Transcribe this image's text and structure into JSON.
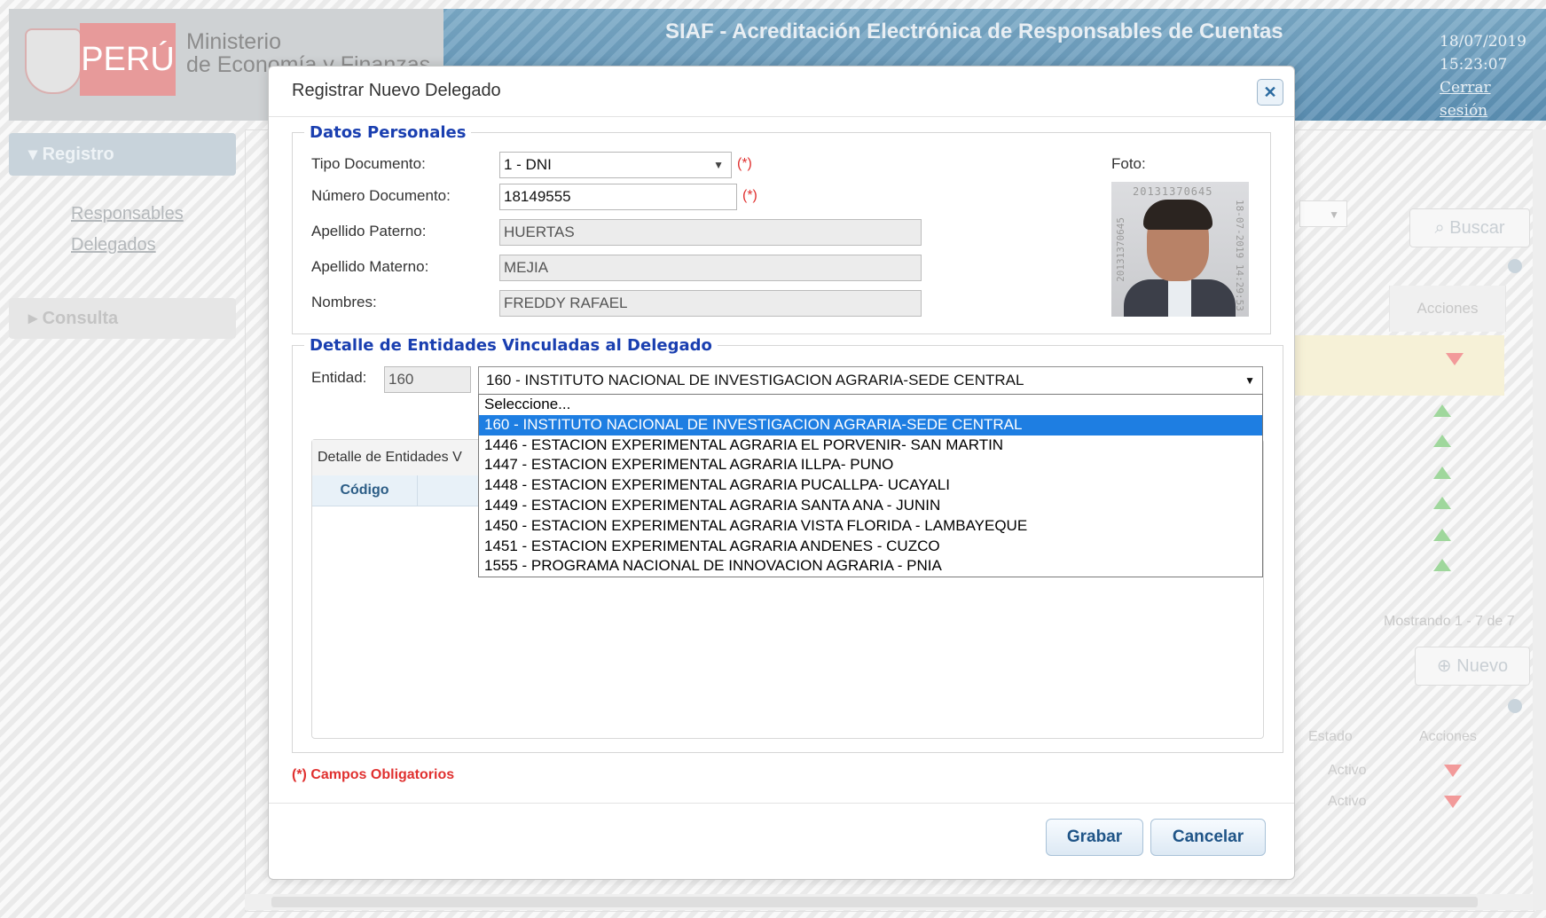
{
  "header": {
    "country": "PERÚ",
    "ministry_line1": "Ministerio",
    "ministry_line2": "de Economía y Finanzas",
    "app_title": "SIAF - Acreditación Electrónica de Responsables de Cuentas",
    "date": "18/07/2019",
    "time": "15:23:07",
    "logout": "Cerrar sesión"
  },
  "sidebar": {
    "registro": "Registro",
    "items": [
      "Responsables",
      "Delegados"
    ],
    "consulta": "Consulta"
  },
  "background": {
    "buscar": "Buscar",
    "acciones": "Acciones",
    "mostrando": "Mostrando 1 - 7 de 7",
    "nuevo": "Nuevo",
    "estado": "Estado",
    "acciones2": "Acciones",
    "activo": [
      "Activo",
      "Activo"
    ]
  },
  "dialog": {
    "title": "Registrar Nuevo Delegado",
    "close_icon": "close-icon",
    "datos_personales": {
      "legend": "Datos Personales",
      "tipo_documento_label": "Tipo Documento:",
      "tipo_documento_value": "1 - DNI",
      "numero_documento_label": "Número Documento:",
      "numero_documento_value": "18149555",
      "apellido_paterno_label": "Apellido Paterno:",
      "apellido_paterno_value": "HUERTAS",
      "apellido_materno_label": "Apellido Materno:",
      "apellido_materno_value": "MEJIA",
      "nombres_label": "Nombres:",
      "nombres_value": "FREDDY RAFAEL",
      "required_mark": "(*)",
      "foto_label": "Foto:",
      "photo_stamp_top": "20131370645",
      "photo_stamp_side": "18-07-2019 14:29:53",
      "photo_stamp_left": "20131370645"
    },
    "entidades": {
      "legend": "Detalle de Entidades Vinculadas al Delegado",
      "entidad_label": "Entidad:",
      "entidad_code": "160",
      "selected": "160 - INSTITUTO NACIONAL DE INVESTIGACION AGRARIA-SEDE CENTRAL",
      "options": [
        "Seleccione...",
        "160 - INSTITUTO NACIONAL DE INVESTIGACION AGRARIA-SEDE CENTRAL",
        "1446 - ESTACION EXPERIMENTAL AGRARIA EL PORVENIR- SAN MARTIN",
        "1447 - ESTACION EXPERIMENTAL AGRARIA ILLPA- PUNO",
        "1448 - ESTACION EXPERIMENTAL AGRARIA PUCALLPA- UCAYALI",
        "1449 - ESTACION EXPERIMENTAL AGRARIA SANTA ANA - JUNIN",
        "1450 - ESTACION EXPERIMENTAL AGRARIA VISTA FLORIDA - LAMBAYEQUE",
        "1451 - ESTACION EXPERIMENTAL AGRARIA ANDENES - CUZCO",
        "1555 - PROGRAMA NACIONAL DE INNOVACION AGRARIA - PNIA"
      ],
      "grid_title": "Detalle de Entidades V",
      "grid_col_codigo": "Código"
    },
    "required_note": "(*) Campos Obligatorios",
    "grabar": "Grabar",
    "cancelar": "Cancelar"
  }
}
